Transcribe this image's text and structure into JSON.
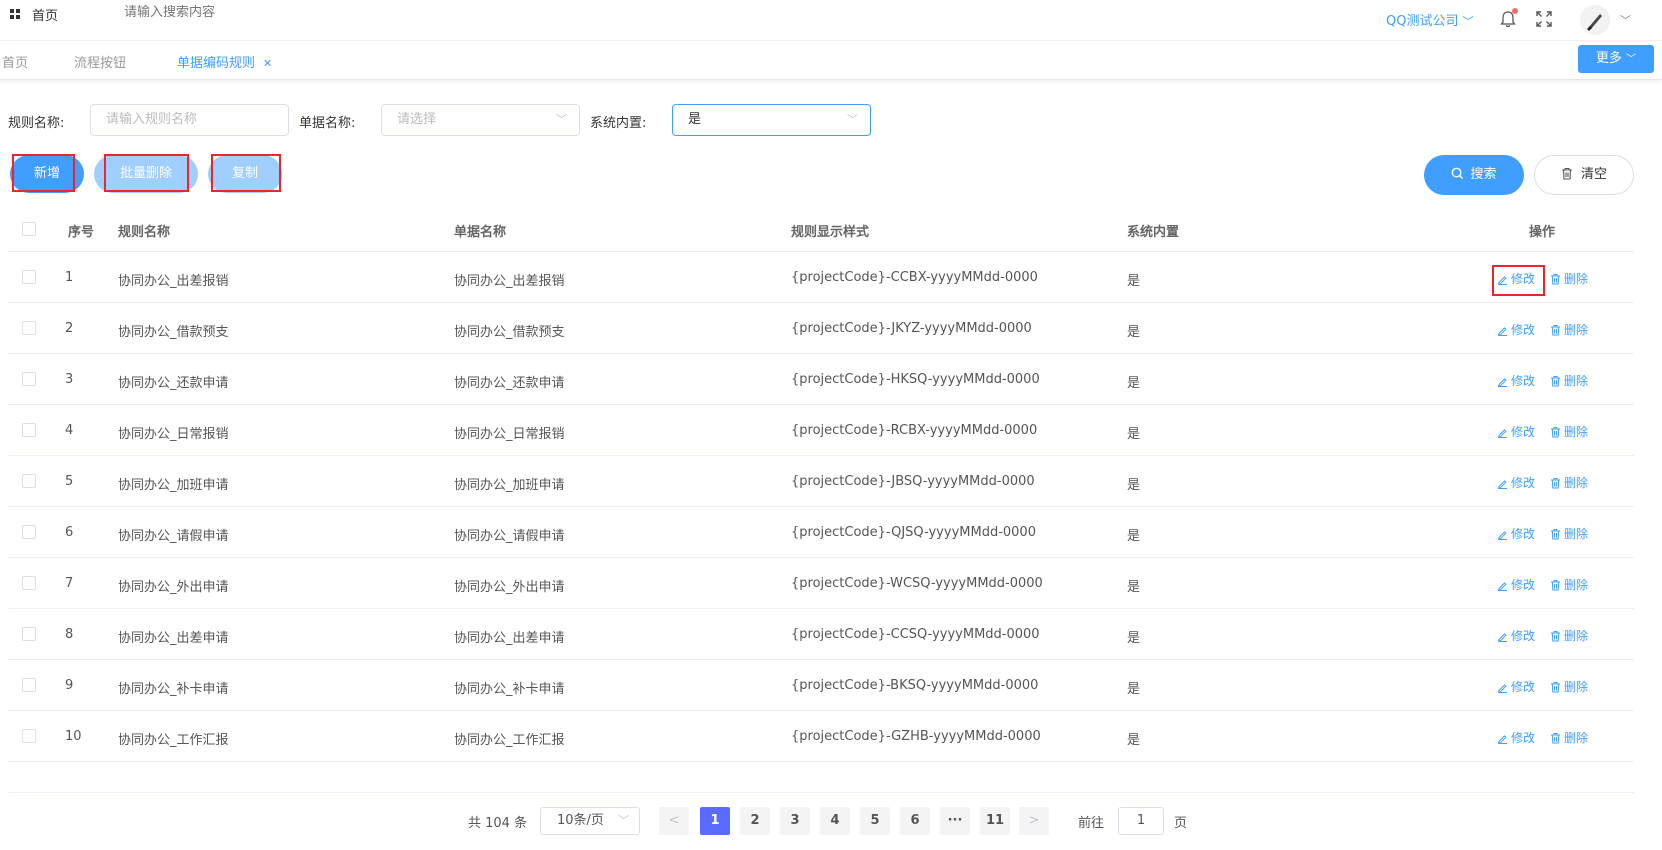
{
  "header": {
    "home_label": "首页",
    "search_placeholder": "请输入搜索内容",
    "company": "QQ测试公司",
    "icons": [
      "grid-icon",
      "bell-icon",
      "fullscreen-icon",
      "avatar"
    ]
  },
  "tabs": [
    {
      "label": "首页",
      "active": false
    },
    {
      "label": "流程按钮",
      "active": false
    },
    {
      "label": "单据编码规则",
      "active": true
    }
  ],
  "more_label": "更多",
  "filters": {
    "rule_name_label": "规则名称:",
    "rule_name_placeholder": "请输入规则名称",
    "doc_name_label": "单据名称:",
    "doc_name_placeholder": "请选择",
    "builtin_label": "系统内置:",
    "builtin_value": "是"
  },
  "actions": {
    "add": "新增",
    "batch_delete": "批量删除",
    "copy": "复制",
    "search": "搜索",
    "clear": "清空"
  },
  "table": {
    "headers": [
      "序号",
      "规则名称",
      "单据名称",
      "规则显示样式",
      "系统内置",
      "操作"
    ],
    "edit_label": "修改",
    "delete_label": "删除",
    "rows": [
      {
        "no": "1",
        "rule": "协同办公_出差报销",
        "doc": "协同办公_出差报销",
        "pattern": "{projectCode}-CCBX-yyyyMMdd-0000",
        "builtin": "是"
      },
      {
        "no": "2",
        "rule": "协同办公_借款预支",
        "doc": "协同办公_借款预支",
        "pattern": "{projectCode}-JKYZ-yyyyMMdd-0000",
        "builtin": "是"
      },
      {
        "no": "3",
        "rule": "协同办公_还款申请",
        "doc": "协同办公_还款申请",
        "pattern": "{projectCode}-HKSQ-yyyyMMdd-0000",
        "builtin": "是"
      },
      {
        "no": "4",
        "rule": "协同办公_日常报销",
        "doc": "协同办公_日常报销",
        "pattern": "{projectCode}-RCBX-yyyyMMdd-0000",
        "builtin": "是"
      },
      {
        "no": "5",
        "rule": "协同办公_加班申请",
        "doc": "协同办公_加班申请",
        "pattern": "{projectCode}-JBSQ-yyyyMMdd-0000",
        "builtin": "是"
      },
      {
        "no": "6",
        "rule": "协同办公_请假申请",
        "doc": "协同办公_请假申请",
        "pattern": "{projectCode}-QJSQ-yyyyMMdd-0000",
        "builtin": "是"
      },
      {
        "no": "7",
        "rule": "协同办公_外出申请",
        "doc": "协同办公_外出申请",
        "pattern": "{projectCode}-WCSQ-yyyyMMdd-0000",
        "builtin": "是"
      },
      {
        "no": "8",
        "rule": "协同办公_出差申请",
        "doc": "协同办公_出差申请",
        "pattern": "{projectCode}-CCSQ-yyyyMMdd-0000",
        "builtin": "是"
      },
      {
        "no": "9",
        "rule": "协同办公_补卡申请",
        "doc": "协同办公_补卡申请",
        "pattern": "{projectCode}-BKSQ-yyyyMMdd-0000",
        "builtin": "是"
      },
      {
        "no": "10",
        "rule": "协同办公_工作汇报",
        "doc": "协同办公_工作汇报",
        "pattern": "{projectCode}-GZHB-yyyyMMdd-0000",
        "builtin": "是"
      }
    ]
  },
  "pagination": {
    "total": "共 104 条",
    "page_size": "10条/页",
    "pages": [
      "1",
      "2",
      "3",
      "4",
      "5",
      "6",
      "···",
      "11"
    ],
    "current": "1",
    "goto_label": "前往",
    "goto_value": "1",
    "page_unit": "页"
  },
  "colors": {
    "primary": "#409eff",
    "primary_light": "#a0cfff",
    "highlight_box": "#e8262c",
    "page_active": "#5c6bff"
  }
}
